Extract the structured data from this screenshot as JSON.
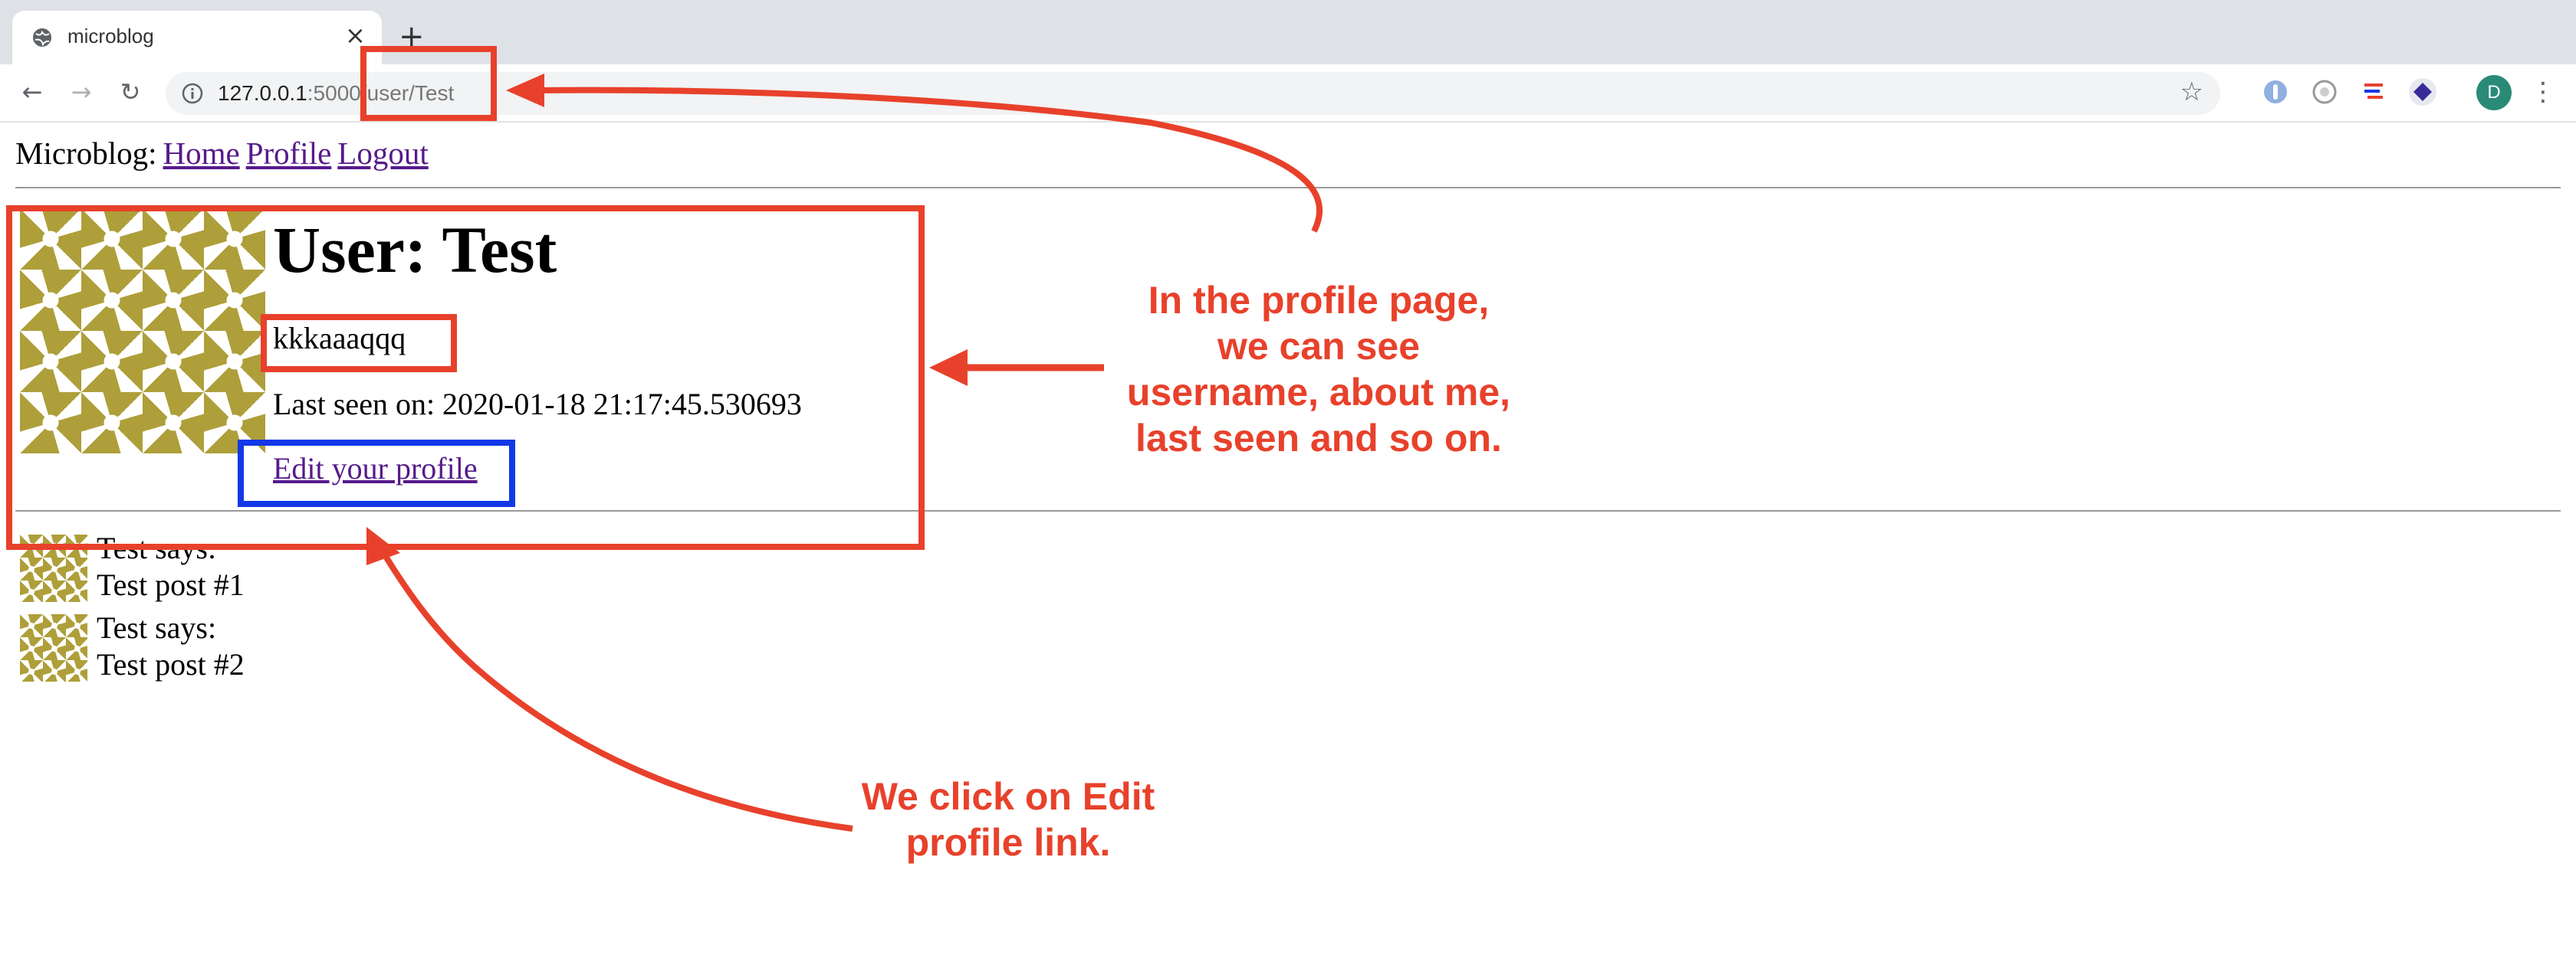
{
  "browser": {
    "tab_title": "microblog",
    "tab_close": "×",
    "new_tab": "+",
    "back": "←",
    "forward": "→",
    "reload": "↻",
    "url_host": "127.0.0.1",
    "url_rest": ":5000/user/Test",
    "bookmark_star": "☆",
    "profile_initial": "D",
    "menu": "⋮"
  },
  "nav": {
    "brand": "Microblog:",
    "links": [
      "Home",
      "Profile",
      "Logout"
    ]
  },
  "profile": {
    "heading": "User: Test",
    "about_me": "kkkaaaqqq",
    "last_seen": "Last seen on: 2020-01-18 21:17:45.530693",
    "edit_link": "Edit your profile"
  },
  "posts": [
    {
      "author_line": "Test says:",
      "body": "Test post #1"
    },
    {
      "author_line": "Test says:",
      "body": "Test post #2"
    }
  ],
  "annotations": {
    "profile_note": [
      "In the profile page,",
      "we can see",
      "username, about me,",
      "last seen and so on."
    ],
    "click_note": [
      "We click on Edit",
      "profile link."
    ]
  },
  "colors": {
    "annotation_red": "#e8412b",
    "highlight_blue": "#1238e8",
    "identicon_gold": "#ae9f3a",
    "visited_link": "#551a8b"
  }
}
